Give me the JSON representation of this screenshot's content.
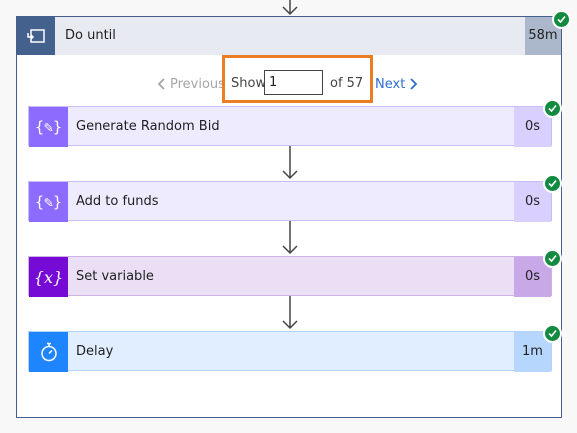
{
  "loop": {
    "title": "Do until",
    "duration": "58m"
  },
  "pager": {
    "previous_label": "Previous",
    "show_label": "Show",
    "page_value": "1",
    "of_label": "of 57",
    "next_label": "Next"
  },
  "steps": [
    {
      "title": "Generate Random Bid",
      "duration": "0s",
      "icon": "compose-icon"
    },
    {
      "title": "Add to funds",
      "duration": "0s",
      "icon": "compose-icon"
    },
    {
      "title": "Set variable",
      "duration": "0s",
      "icon": "variable-icon"
    },
    {
      "title": "Delay",
      "duration": "1m",
      "icon": "timer-icon"
    }
  ],
  "colors": {
    "loop_header": "#44618d",
    "compose": "#8c6cff",
    "variable": "#770bd6",
    "delay": "#1f85ff",
    "success": "#128a3f",
    "highlight": "#eb7e23"
  }
}
